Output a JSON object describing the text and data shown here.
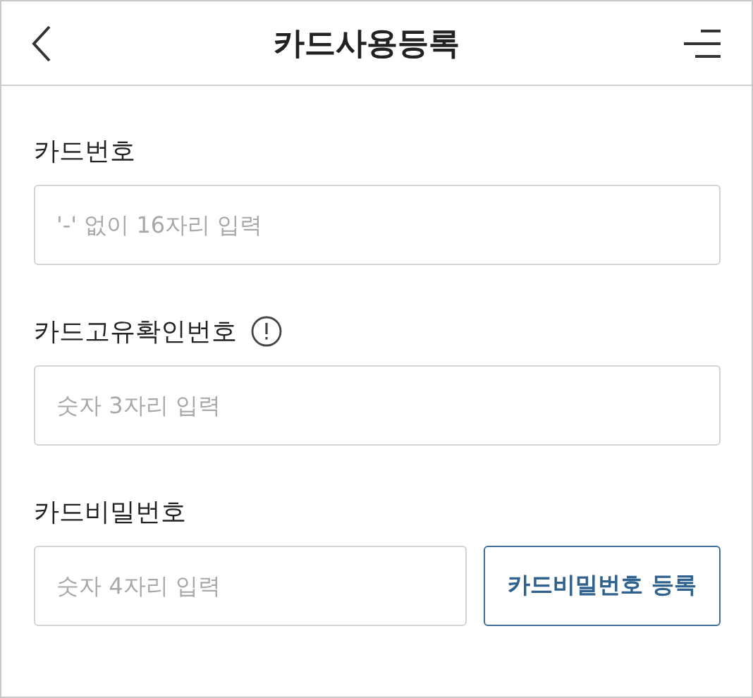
{
  "header": {
    "title": "카드사용등록"
  },
  "fields": [
    {
      "kind": "plain",
      "label": "카드번호",
      "placeholder": "'-' 없이 16자리 입력"
    },
    {
      "kind": "info",
      "label": "카드고유확인번호",
      "placeholder": "숫자 3자리 입력"
    },
    {
      "kind": "action",
      "label": "카드비밀번호",
      "placeholder": "숫자 4자리 입력",
      "button": "카드비밀번호 등록"
    }
  ]
}
